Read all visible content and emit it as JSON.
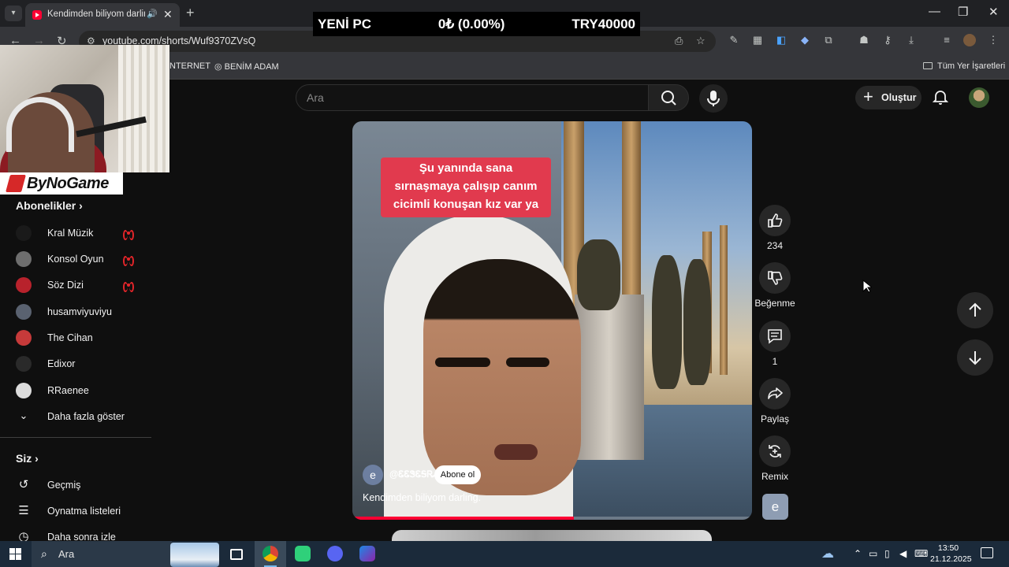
{
  "browser": {
    "tab_title": "Kendimden biliyom darling",
    "url": "youtube.com/shorts/Wuf9370ZVsQ",
    "bookmarks": [
      "NTERNET",
      "BENİM ADAM",
      "Tüm Yer İşaretleri"
    ]
  },
  "ticker": {
    "name": "YENİ PC",
    "change": "0₺ (0.00%)",
    "target": "TRY40000"
  },
  "webcam": {
    "brand": "ByNoGame"
  },
  "header": {
    "search_placeholder": "Ara",
    "create_label": "Oluştur"
  },
  "sidebar": {
    "subscriptions_title": "Abonelikler",
    "subscriptions": [
      {
        "label": "Kral Müzik",
        "live": true,
        "color": "#1a1a1a"
      },
      {
        "label": "Konsol Oyun",
        "live": true,
        "color": "#6e6e6e"
      },
      {
        "label": "Söz Dizi",
        "live": true,
        "color": "#b8222c"
      },
      {
        "label": "husamviyuviyu",
        "live": false,
        "color": "#5a6270"
      },
      {
        "label": "The Cihan",
        "live": false,
        "color": "#c63a3a"
      },
      {
        "label": "Edixor",
        "live": false,
        "color": "#2a2a2a"
      },
      {
        "label": "RRaenee",
        "live": false,
        "color": "#dcdcdc"
      }
    ],
    "show_more": "Daha fazla göster",
    "you_title": "Siz",
    "you_items": [
      "Geçmiş",
      "Oynatma listeleri",
      "Daha sonra izle"
    ]
  },
  "short": {
    "caption_lines": [
      "Şu yanında sana",
      "sırnaşmaya çalışıp canım",
      "cicimli konuşan kız var ya"
    ],
    "channel_initial": "e",
    "channel_handle": "@ᏋᏋᏕᏋᎦᏒᏗ",
    "subscribe_label": "Abone ol",
    "description": "Kendimden biliyom darling.",
    "progress": 0.555
  },
  "actions": {
    "like_count": "234",
    "dislike_label": "Beğenme",
    "comment_count": "1",
    "share_label": "Paylaş",
    "remix_label": "Remix",
    "channel_initial": "e"
  },
  "taskbar": {
    "search_placeholder": "Ara",
    "time": "13:50",
    "date": "21.12.2025"
  },
  "colors": {
    "brand_red": "#ff0033",
    "accent": "#e13a4e"
  }
}
